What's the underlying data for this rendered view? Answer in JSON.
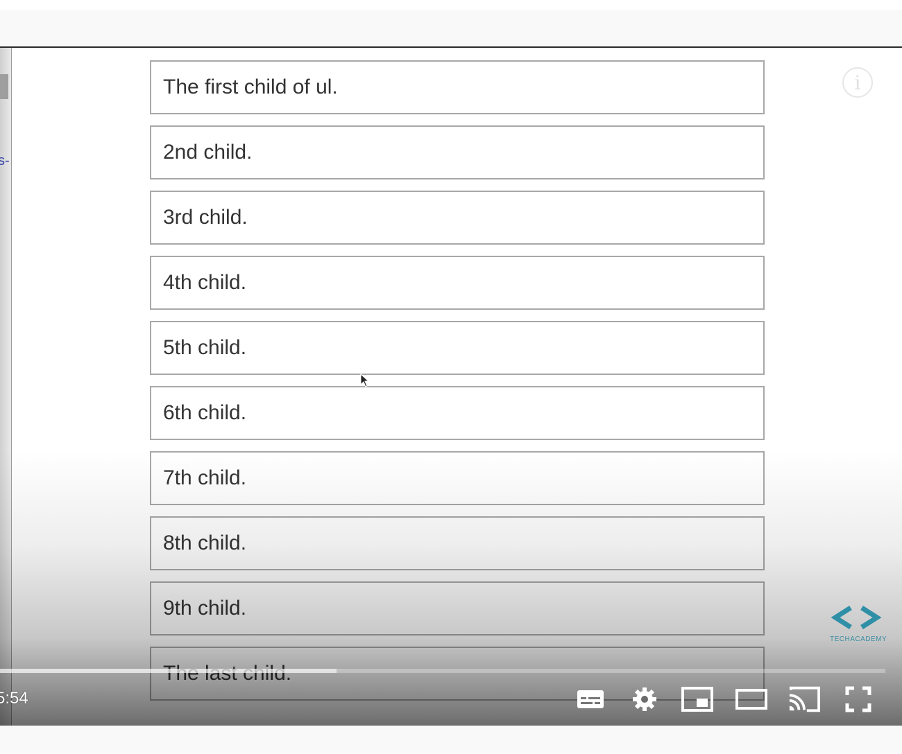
{
  "list": {
    "items": [
      "The first child of ul.",
      "2nd child.",
      "3rd child.",
      "4th child.",
      "5th child.",
      "6th child.",
      "7th child.",
      "8th child.",
      "9th child.",
      "The last child."
    ]
  },
  "side_fragment": "s-",
  "overlay": {
    "info_icon_glyph": "i",
    "logo_text": "TECHACADEMY"
  },
  "player": {
    "time_display": "5:54",
    "progress_fraction": 0.38,
    "controls": [
      "subtitles-icon",
      "settings-gear-icon",
      "miniplayer-icon",
      "theater-mode-icon",
      "cast-icon",
      "fullscreen-icon"
    ]
  },
  "colors": {
    "logo_accent": "#2f8fa6",
    "item_border": "#a8a8a8",
    "link_fragment": "#3645b0"
  }
}
